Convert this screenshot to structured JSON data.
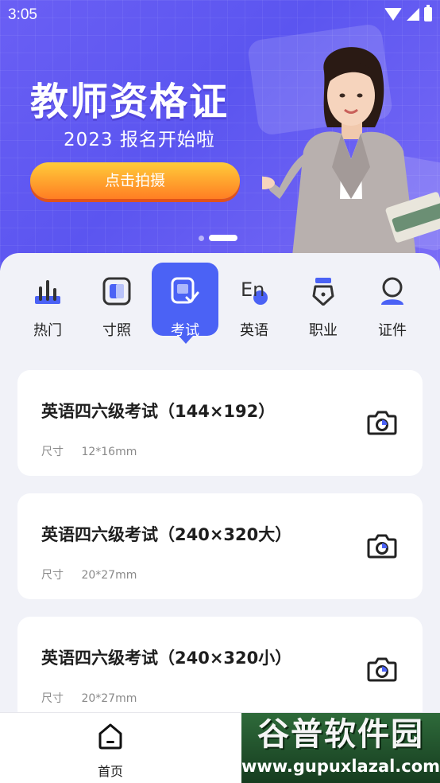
{
  "status_bar": {
    "time": "3:05"
  },
  "banner": {
    "title": "教师资格证",
    "subtitle": "2023 报名开始啦",
    "button_label": "点击拍摄",
    "page_count": 2,
    "active_page": 2
  },
  "categories": [
    {
      "label": "热门",
      "icon": "bar-chart-icon",
      "active": false
    },
    {
      "label": "寸照",
      "icon": "photo-frame-icon",
      "active": false
    },
    {
      "label": "考试",
      "icon": "exam-check-icon",
      "active": true
    },
    {
      "label": "英语",
      "icon": "english-en-icon",
      "active": false
    },
    {
      "label": "职业",
      "icon": "pen-nib-icon",
      "active": false
    },
    {
      "label": "证件",
      "icon": "person-id-icon",
      "active": false
    }
  ],
  "cards": [
    {
      "title": "英语四六级考试（144×192）",
      "size_label": "尺寸",
      "size_value": "12*16mm"
    },
    {
      "title": "英语四六级考试（240×320大）",
      "size_label": "尺寸",
      "size_value": "20*27mm"
    },
    {
      "title": "英语四六级考试（240×320小）",
      "size_label": "尺寸",
      "size_value": "20*27mm"
    }
  ],
  "bottom_nav": {
    "home_label": "首页"
  },
  "watermark": {
    "title": "谷普软件园",
    "url": "www.gupuxlazal.com"
  },
  "colors": {
    "accent": "#4b62f5",
    "banner": "#5b55f0",
    "cta_start": "#ffcc3a",
    "cta_end": "#ff7e23"
  }
}
